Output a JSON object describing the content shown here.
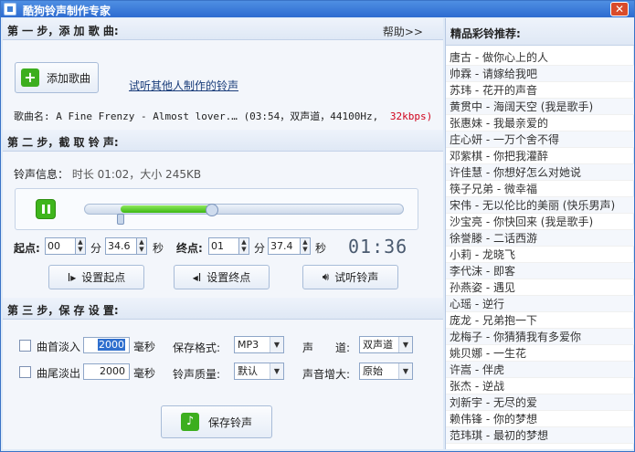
{
  "app": {
    "title": "酷狗铃声制作专家",
    "close": "✕"
  },
  "step1": {
    "title": "第 一 步，添 加 歌 曲:",
    "help": "帮助>>",
    "add_button": "添加歌曲",
    "listen_link": "试听其他人制作的铃声",
    "song_label": "歌曲名:",
    "song_name": "A Fine Frenzy - Almost lover.…",
    "song_meta": "(03:54，双声道，44100Hz,",
    "song_bitrate": "32kbps)"
  },
  "step2": {
    "title": "第 二 步，截 取 铃 声:",
    "info_label": "铃声信息：",
    "info_value": "时长 01:02，大小 245KB",
    "progress": {
      "start_fraction": 0.11,
      "end_fraction": 0.397
    },
    "start_label": "起点:",
    "start_min": "00",
    "start_sec": "34.6",
    "end_label": "终点:",
    "end_min": "01",
    "end_sec": "37.4",
    "unit_min": "分",
    "unit_sec": "秒",
    "timer": "01:36",
    "set_start": "设置起点",
    "set_end": "设置终点",
    "preview": "试听铃声"
  },
  "step3": {
    "title": "第 三 步，保 存 设 置:",
    "fade_in_label": "曲首淡入",
    "fade_in_value": "2000",
    "fade_out_label": "曲尾淡出",
    "fade_out_value": "2000",
    "ms": "毫秒",
    "format_label": "保存格式:",
    "format_value": "MP3",
    "quality_label": "铃声质量:",
    "quality_value": "默认",
    "channel_label": "声　　道:",
    "channel_value": "双声道",
    "boost_label": "声音增大:",
    "boost_value": "原始",
    "save_button": "保存铃声"
  },
  "sidebar": {
    "title": "精品彩铃推荐:",
    "items": [
      "唐古 - 做你心上的人",
      "帅霖 - 请嫁给我吧",
      "苏玮 - 花开的声音",
      "黄贯中 - 海阔天空 (我是歌手)",
      "张惠妹 - 我最亲爱的",
      "庄心妍 - 一万个舍不得",
      "邓紫棋 - 你把我灌醉",
      "许佳慧 - 你想好怎么对她说",
      "筷子兄弟 - 微幸福",
      "宋伟 - 无以伦比的美丽 (快乐男声)",
      "沙宝亮 - 你快回来 (我是歌手)",
      "徐誉滕 - 二话西游",
      "小莉 - 龙晓飞",
      "李代沫 - 即客",
      "孙燕姿 - 遇见",
      "心瑶 - 逆行",
      "庞龙 - 兄弟抱一下",
      "龙梅子 - 你猜猜我有多爱你",
      "姚贝娜 - 一生花",
      "许嵩 - 伴虎",
      "张杰 - 逆战",
      "刘新宇 - 无尽的爱",
      "赖伟锋 - 你的梦想",
      "范玮琪 - 最初的梦想"
    ]
  },
  "colors": {
    "accent": "#2d6bd0",
    "green": "#44c21a",
    "bitrate": "#d0021b"
  }
}
